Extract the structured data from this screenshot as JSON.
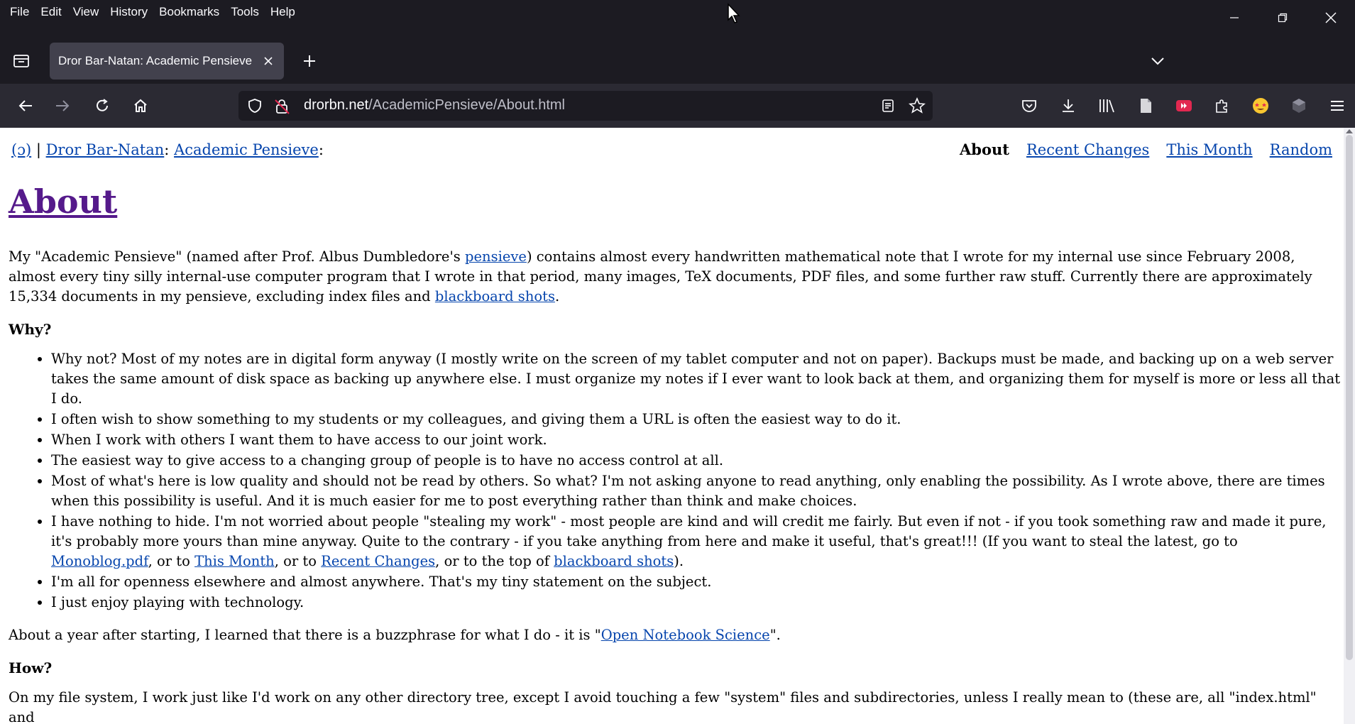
{
  "menubar": {
    "items": [
      "File",
      "Edit",
      "View",
      "History",
      "Bookmarks",
      "Tools",
      "Help"
    ]
  },
  "tabs": {
    "active_title": "Dror Bar-Natan: Academic Pensieve"
  },
  "urlbar": {
    "host": "drorbn.net",
    "path": "/AcademicPensieve/About.html"
  },
  "page": {
    "breadcrumb": {
      "hebrew_link": "(ɔ)",
      "sep1": " | ",
      "author_link": "Dror Bar-Natan",
      "colon1": ": ",
      "pensieve_link": "Academic Pensieve",
      "colon2": ":"
    },
    "topnav": {
      "about": "About",
      "recent_changes": "Recent Changes",
      "this_month": "This Month",
      "random": "Random"
    },
    "title": "About",
    "intro": {
      "t1": "My \"Academic Pensieve\" (named after Prof. Albus Dumbledore's ",
      "pensieve_link": "pensieve",
      "t2": ") contains almost every handwritten mathematical note that I wrote for my internal use since February 2008, almost every tiny silly internal-use computer program that I wrote in that period, many images, TeX documents, PDF files, and some further raw stuff. Currently there are approximately 15,334 documents in my pensieve, excluding index files and ",
      "blackboard_link": "blackboard shots",
      "t3": "."
    },
    "why_heading": "Why?",
    "why_items": {
      "i1": "Why not? Most of my notes are in digital form anyway (I mostly write on the screen of my tablet computer and not on paper). Backups must be made, and backing up on a web server takes the same amount of disk space as backing up anywhere else. I must organize my notes if I ever want to look back at them, and organizing them for myself is more or less all that I do.",
      "i2": "I often wish to show something to my students or my colleagues, and giving them a URL is often the easiest way to do it.",
      "i3": "When I work with others I want them to have access to our joint work.",
      "i4": "The easiest way to give access to a changing group of people is to have no access control at all.",
      "i5": "Most of what's here is low quality and should not be read by others. So what? I'm not asking anyone to read anything, only enabling the possibility. As I wrote above, there are times when this possibility is useful. And it is much easier for me to post everything rather than think and make choices.",
      "i6a": "I have nothing to hide. I'm not worried about people \"stealing my work\" - most people are kind and will credit me fairly. But even if not - if you took something raw and made it pure, it's probably more yours than mine anyway. Quite to the contrary - if you take anything from here and make it useful, that's great!!! (If you want to steal the latest, go to ",
      "i6_monoblog": "Monoblog.pdf",
      "i6b": ", or to ",
      "i6_thismonth": "This Month",
      "i6c": ", or to ",
      "i6_recent": "Recent Changes",
      "i6d": ", or to the top of ",
      "i6_blackboard": "blackboard shots",
      "i6e": ").",
      "i7": "I'm all for openness elsewhere and almost anywhere. That's my tiny statement on the subject.",
      "i8": "I just enjoy playing with technology."
    },
    "buzz": {
      "t1": "About a year after starting, I learned that there is a buzzphrase for what I do - it is \"",
      "link": "Open Notebook Science",
      "t2": "\"."
    },
    "how_heading": "How?",
    "how_text": "On my file system, I work just like I'd work on any other directory tree, except I avoid touching a few \"system\" files and subdirectories, unless I really mean to (these are, all \"index.html\" and"
  }
}
